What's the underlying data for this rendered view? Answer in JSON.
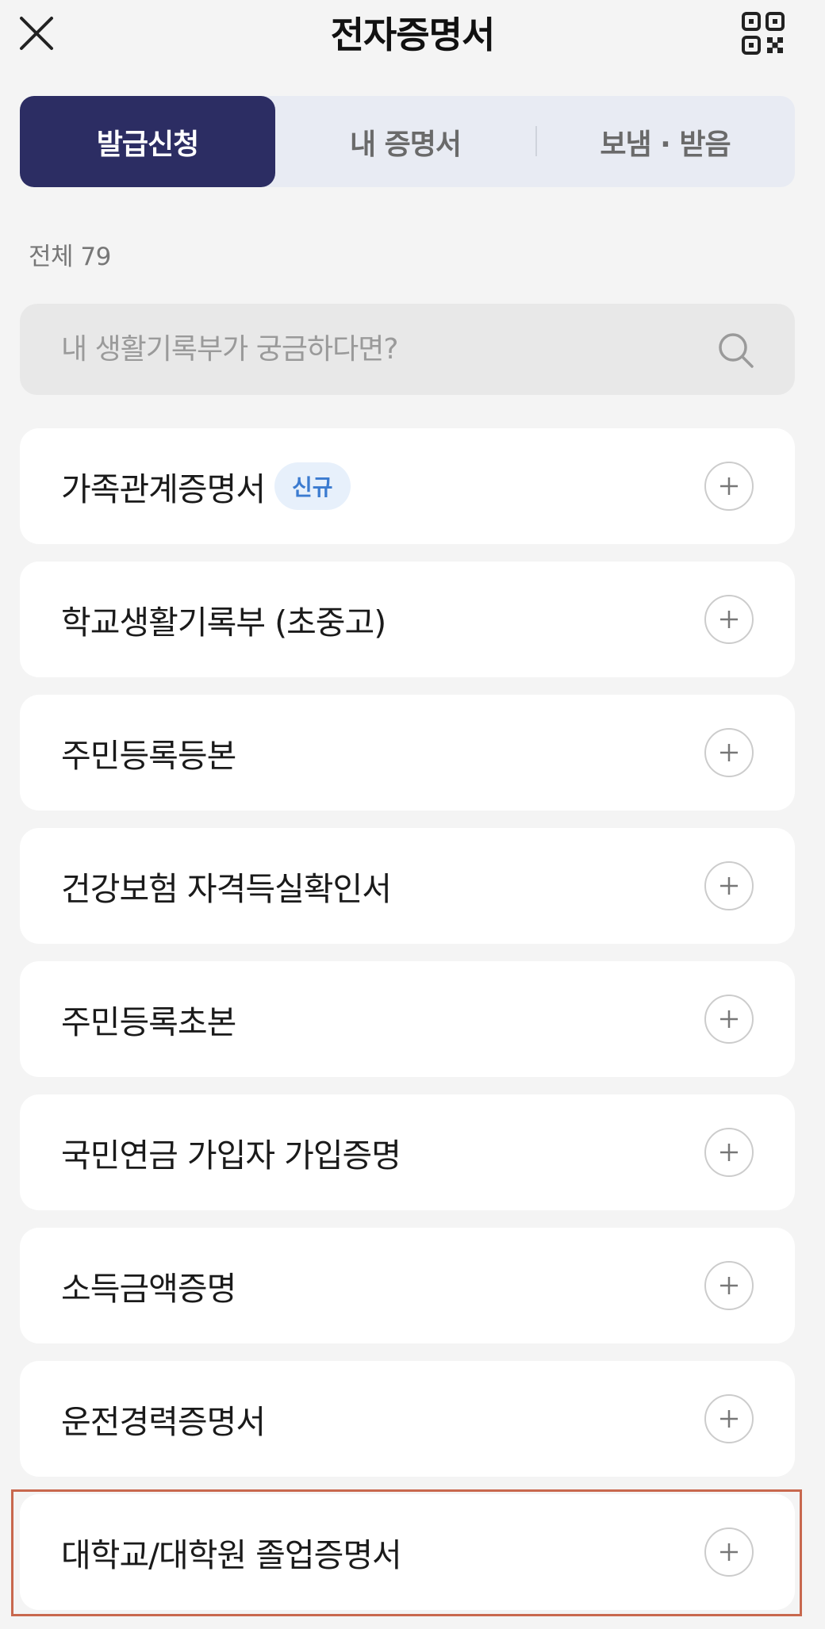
{
  "header": {
    "title": "전자증명서",
    "close_icon": "close-icon",
    "qr_icon": "qr-code-icon"
  },
  "tabs": [
    {
      "label": "발급신청",
      "active": true
    },
    {
      "label": "내 증명서",
      "active": false
    },
    {
      "label": "보냄 · 받음",
      "active": false
    }
  ],
  "count_label": "전체 79",
  "search": {
    "placeholder": "내 생활기록부가 궁금하다면?",
    "value": "",
    "icon": "search-icon"
  },
  "items": [
    {
      "label": "가족관계증명서",
      "badge": "신규"
    },
    {
      "label": "학교생활기록부 (초중고)"
    },
    {
      "label": "주민등록등본"
    },
    {
      "label": "건강보험 자격득실확인서"
    },
    {
      "label": "주민등록초본"
    },
    {
      "label": "국민연금 가입자 가입증명"
    },
    {
      "label": "소득금액증명"
    },
    {
      "label": "운전경력증명서"
    },
    {
      "label": "대학교/대학원 졸업증명서"
    }
  ],
  "colors": {
    "active_tab": "#2c2d63",
    "tab_bg": "#e8ebf3",
    "badge_text": "#3b7bd0",
    "badge_bg": "#e7f0fb",
    "highlight": "#c8684e"
  }
}
